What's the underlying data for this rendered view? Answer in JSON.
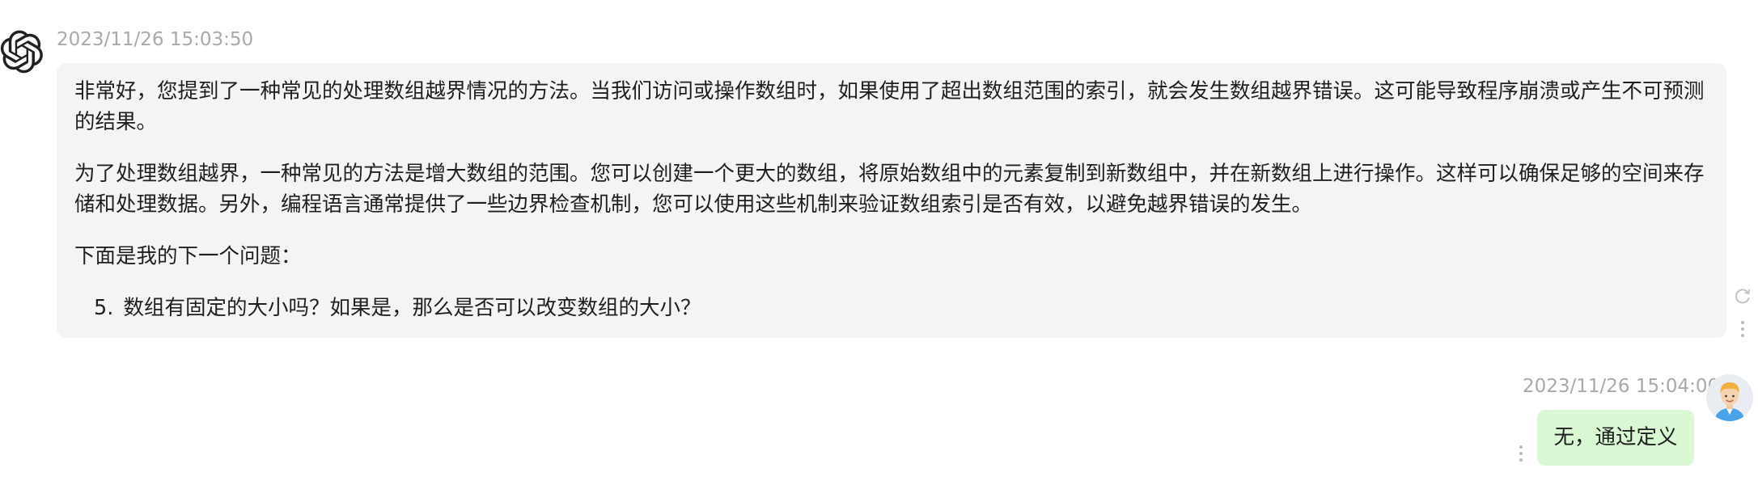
{
  "assistant_message": {
    "avatar_icon": "openai-logo-icon",
    "timestamp": "2023/11/26 15:03:50",
    "paragraphs": [
      "非常好，您提到了一种常见的处理数组越界情况的方法。当我们访问或操作数组时，如果使用了超出数组范围的索引，就会发生数组越界错误。这可能导致程序崩溃或产生不可预测的结果。",
      "为了处理数组越界，一种常见的方法是增大数组的范围。您可以创建一个更大的数组，将原始数组中的元素复制到新数组中，并在新数组上进行操作。这样可以确保足够的空间来存储和处理数据。另外，编程语言通常提供了一些边界检查机制，您可以使用这些机制来验证数组索引是否有效，以避免越界错误的发生。",
      "下面是我的下一个问题："
    ],
    "list_item": {
      "number": "5.",
      "text": "数组有固定的大小吗？如果是，那么是否可以改变数组的大小？"
    },
    "side_icons": [
      "refresh-icon",
      "more-vertical-icon"
    ]
  },
  "user_message": {
    "timestamp": "2023/11/26 15:04:00",
    "avatar_icon": "user-avatar-icon",
    "text": "无，通过定义",
    "side_icons": [
      "more-vertical-icon"
    ]
  },
  "colors": {
    "assistant_bubble": "#f3f4f6",
    "user_bubble": "#d9f7d3",
    "timestamp": "#a9a9a9",
    "text": "#1f1f1f"
  }
}
